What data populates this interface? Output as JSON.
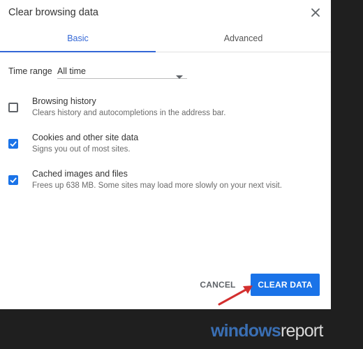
{
  "dialog": {
    "title": "Clear browsing data",
    "close_icon": "close-icon"
  },
  "tabs": [
    {
      "label": "Basic",
      "active": true
    },
    {
      "label": "Advanced",
      "active": false
    }
  ],
  "time_range": {
    "label": "Time range",
    "value": "All time",
    "icon": "dropdown-arrow-icon"
  },
  "options": [
    {
      "title": "Browsing history",
      "description": "Clears history and autocompletions in the address bar.",
      "checked": false
    },
    {
      "title": "Cookies and other site data",
      "description": "Signs you out of most sites.",
      "checked": true
    },
    {
      "title": "Cached images and files",
      "description": "Frees up 638 MB. Some sites may load more slowly on your next visit.",
      "checked": true
    }
  ],
  "buttons": {
    "cancel": "CANCEL",
    "clear": "CLEAR DATA"
  },
  "watermark": {
    "part1": "windows",
    "part2": "report"
  },
  "colors": {
    "accent": "#1a73e8",
    "tab_active": "#3367d6",
    "annotation_arrow": "#d32f2f"
  }
}
